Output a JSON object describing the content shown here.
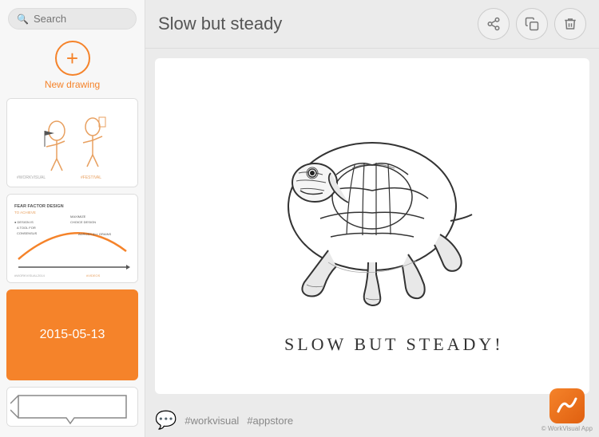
{
  "sidebar": {
    "search_placeholder": "Search",
    "new_drawing_label": "New drawing",
    "thumbnails": [
      {
        "id": "thumb-1",
        "label": "Sketch with figures",
        "date": "",
        "type": "sketch-figures",
        "active": false
      },
      {
        "id": "thumb-2",
        "label": "Text sketch",
        "date": "",
        "type": "sketch-text",
        "active": false
      },
      {
        "id": "thumb-3",
        "label": "2015-05-13",
        "date": "2015-05-13",
        "type": "date-orange",
        "active": true
      },
      {
        "id": "thumb-4",
        "label": "Bottom sketch",
        "date": "",
        "type": "sketch-bottom",
        "active": false
      }
    ]
  },
  "header": {
    "title": "Slow but steady",
    "actions": [
      {
        "id": "share",
        "label": "Share",
        "icon": "share-icon"
      },
      {
        "id": "copy",
        "label": "Copy",
        "icon": "copy-icon"
      },
      {
        "id": "delete",
        "label": "Delete",
        "icon": "trash-icon"
      }
    ]
  },
  "canvas": {
    "alt": "Slow but steady tortoise sketch"
  },
  "footer": {
    "emoji": "💬",
    "hashtags": [
      "#workvisual",
      "#appstore"
    ]
  },
  "logo": {
    "app_name": "WorkVisual App",
    "copyright": "© WorkVisual App"
  }
}
